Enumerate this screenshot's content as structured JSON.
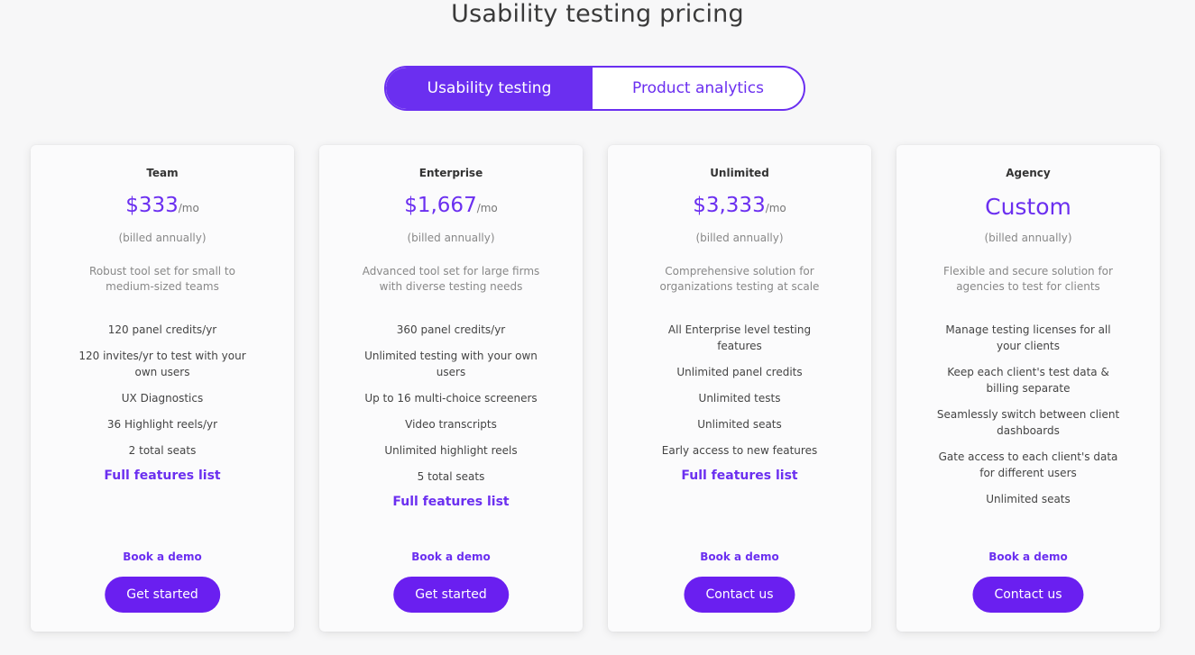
{
  "header": {
    "title": "Usability testing pricing"
  },
  "toggle": {
    "active_label": "Usability testing",
    "inactive_label": "Product analytics"
  },
  "colors": {
    "accent": "#6b2ff0",
    "button": "#6a1ff0",
    "background": "#f7f7f8"
  },
  "plans": [
    {
      "name": "Team",
      "price": "$333",
      "per": "/mo",
      "billed": "(billed annually)",
      "description": "Robust tool set for small to medium-sized teams",
      "features": [
        "120 panel credits/yr",
        "120 invites/yr to test with your own users",
        "UX Diagnostics",
        "36 Highlight reels/yr",
        "2 total seats"
      ],
      "features_link": "Full features list",
      "demo": "Book a demo",
      "cta": "Get started"
    },
    {
      "name": "Enterprise",
      "price": "$1,667",
      "per": "/mo",
      "billed": "(billed annually)",
      "description": "Advanced tool set for large firms with diverse testing needs",
      "features": [
        "360 panel credits/yr",
        "Unlimited testing with your own users",
        "Up to 16 multi-choice screeners",
        "Video transcripts",
        "Unlimited highlight reels",
        "5 total seats"
      ],
      "features_link": "Full features list",
      "demo": "Book a demo",
      "cta": "Get started"
    },
    {
      "name": "Unlimited",
      "price": "$3,333",
      "per": "/mo",
      "billed": "(billed annually)",
      "description": "Comprehensive solution for organizations testing at scale",
      "features": [
        "All Enterprise level testing features",
        "Unlimited panel credits",
        "Unlimited tests",
        "Unlimited seats",
        "Early access to new features"
      ],
      "features_link": "Full features list",
      "demo": "Book a demo",
      "cta": "Contact us"
    },
    {
      "name": "Agency",
      "price": "Custom",
      "per": "",
      "billed": "(billed annually)",
      "description": "Flexible and secure solution for agencies to test for clients",
      "features": [
        "Manage testing licenses for all your clients",
        "Keep each client's test data & billing separate",
        "Seamlessly switch between client dashboards",
        "Gate access to each client's data for different users",
        "Unlimited seats"
      ],
      "features_link": "",
      "demo": "Book a demo",
      "cta": "Contact us"
    }
  ]
}
